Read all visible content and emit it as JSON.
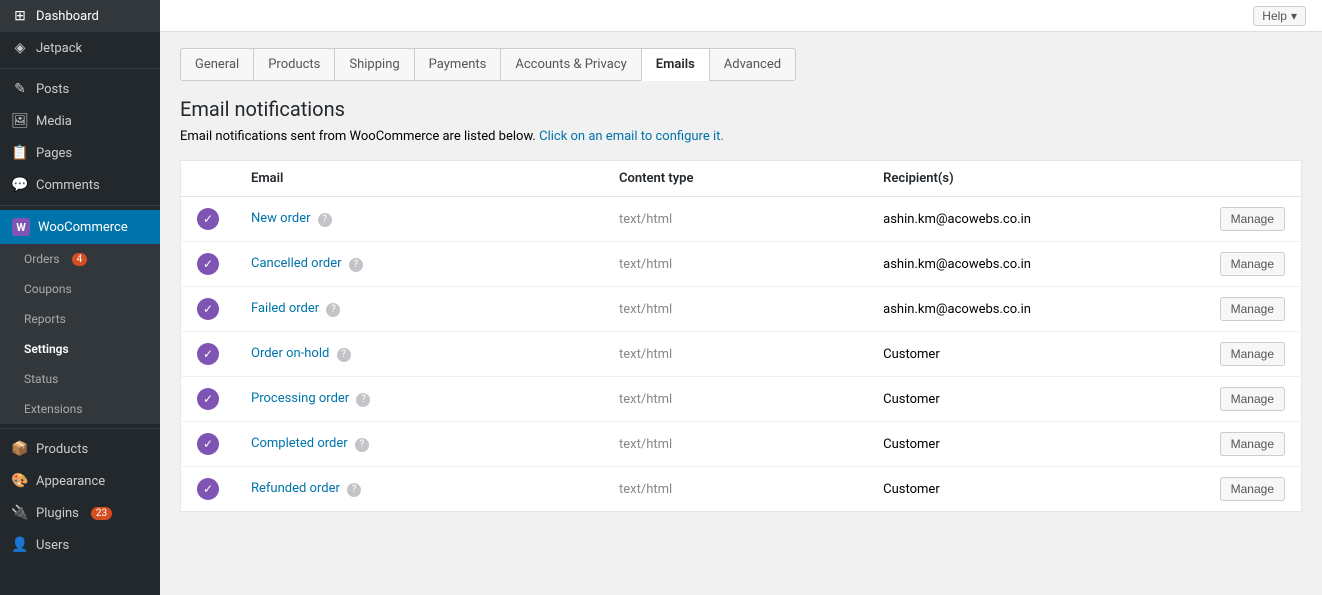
{
  "topbar": {
    "help_label": "Help"
  },
  "sidebar": {
    "items": [
      {
        "id": "dashboard",
        "label": "Dashboard",
        "icon": "⊞",
        "badge": null
      },
      {
        "id": "jetpack",
        "label": "Jetpack",
        "icon": "◈",
        "badge": null
      },
      {
        "id": "posts",
        "label": "Posts",
        "icon": "📄",
        "badge": null
      },
      {
        "id": "media",
        "label": "Media",
        "icon": "🖼",
        "badge": null
      },
      {
        "id": "pages",
        "label": "Pages",
        "icon": "📋",
        "badge": null
      },
      {
        "id": "comments",
        "label": "Comments",
        "icon": "💬",
        "badge": null
      },
      {
        "id": "woocommerce",
        "label": "WooCommerce",
        "icon": "W",
        "badge": null,
        "active": true
      },
      {
        "id": "products",
        "label": "Products",
        "icon": "",
        "badge": null
      },
      {
        "id": "appearance",
        "label": "Appearance",
        "icon": "",
        "badge": null
      },
      {
        "id": "plugins",
        "label": "Plugins",
        "icon": "",
        "badge": "23"
      },
      {
        "id": "users",
        "label": "Users",
        "icon": "",
        "badge": null
      }
    ],
    "sub_items": [
      {
        "id": "orders",
        "label": "Orders",
        "badge": "4"
      },
      {
        "id": "coupons",
        "label": "Coupons",
        "badge": null
      },
      {
        "id": "reports",
        "label": "Reports",
        "badge": null
      },
      {
        "id": "settings",
        "label": "Settings",
        "badge": null,
        "active": true
      },
      {
        "id": "status",
        "label": "Status",
        "badge": null
      },
      {
        "id": "extensions",
        "label": "Extensions",
        "badge": null
      }
    ]
  },
  "tabs": [
    {
      "id": "general",
      "label": "General",
      "active": false
    },
    {
      "id": "products",
      "label": "Products",
      "active": false
    },
    {
      "id": "shipping",
      "label": "Shipping",
      "active": false
    },
    {
      "id": "payments",
      "label": "Payments",
      "active": false
    },
    {
      "id": "accounts-privacy",
      "label": "Accounts & Privacy",
      "active": false
    },
    {
      "id": "emails",
      "label": "Emails",
      "active": true
    },
    {
      "id": "advanced",
      "label": "Advanced",
      "active": false
    }
  ],
  "page": {
    "title": "Email notifications",
    "description_prefix": "Email notifications sent from WooCommerce are listed below.",
    "description_link": "Click on an email to configure it."
  },
  "table": {
    "columns": {
      "email": "Email",
      "content_type": "Content type",
      "recipients": "Recipient(s)"
    },
    "rows": [
      {
        "id": "new-order",
        "enabled": true,
        "name": "New order",
        "content_type": "text/html",
        "recipient": "ashin.km@acowebs.co.in",
        "manage_label": "Manage"
      },
      {
        "id": "cancelled-order",
        "enabled": true,
        "name": "Cancelled order",
        "content_type": "text/html",
        "recipient": "ashin.km@acowebs.co.in",
        "manage_label": "Manage"
      },
      {
        "id": "failed-order",
        "enabled": true,
        "name": "Failed order",
        "content_type": "text/html",
        "recipient": "ashin.km@acowebs.co.in",
        "manage_label": "Manage"
      },
      {
        "id": "order-on-hold",
        "enabled": true,
        "name": "Order on-hold",
        "content_type": "text/html",
        "recipient": "Customer",
        "manage_label": "Manage"
      },
      {
        "id": "processing-order",
        "enabled": true,
        "name": "Processing order",
        "content_type": "text/html",
        "recipient": "Customer",
        "manage_label": "Manage"
      },
      {
        "id": "completed-order",
        "enabled": true,
        "name": "Completed order",
        "content_type": "text/html",
        "recipient": "Customer",
        "manage_label": "Manage"
      },
      {
        "id": "refunded-order",
        "enabled": true,
        "name": "Refunded order",
        "content_type": "text/html",
        "recipient": "Customer",
        "manage_label": "Manage"
      }
    ]
  }
}
